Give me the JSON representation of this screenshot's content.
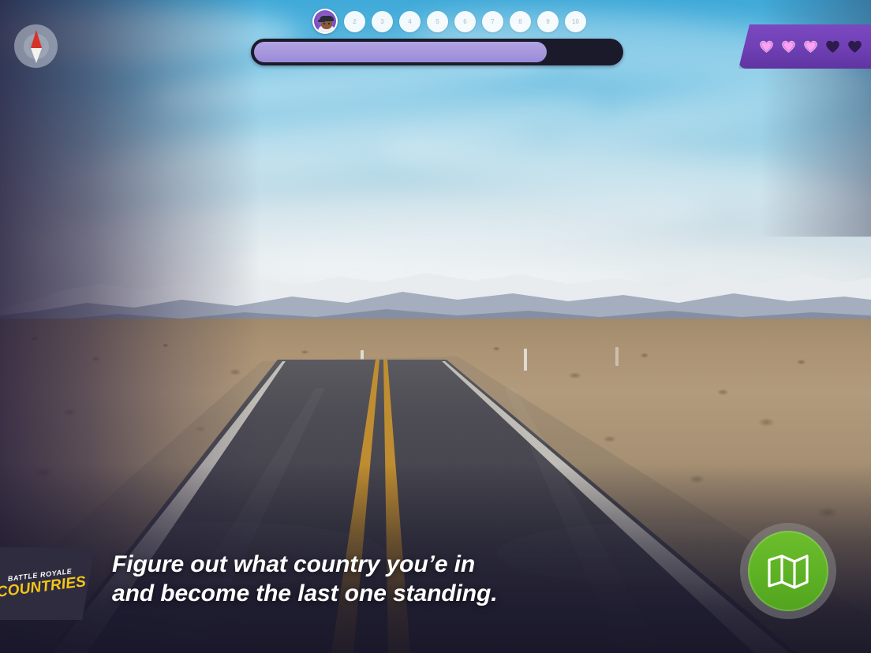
{
  "game": {
    "title_top": "BATTLE ROYALE",
    "title_bottom": "COUNTRIES"
  },
  "tagline": {
    "line1": "Figure out what country you’e in",
    "line2": "and become the last one standing."
  },
  "hud": {
    "compass_icon": "compass-needle-icon",
    "progress": {
      "percent": 80,
      "fill_color": "#a596dd",
      "track_color": "#1b1a2b"
    },
    "player_track": {
      "avatar_label": "1",
      "avatar_bg_color": "#7d4fc0",
      "dots": [
        "2",
        "3",
        "4",
        "5",
        "6",
        "7",
        "8",
        "9",
        "10"
      ]
    },
    "lives": {
      "total": 5,
      "remaining": 3,
      "filled_color": "#f07ce8",
      "empty_color": "#2d1b4d",
      "panel_color": "#6f3fb4"
    }
  },
  "actions": {
    "map_button": {
      "icon": "map-icon",
      "color": "#5cb024"
    }
  }
}
